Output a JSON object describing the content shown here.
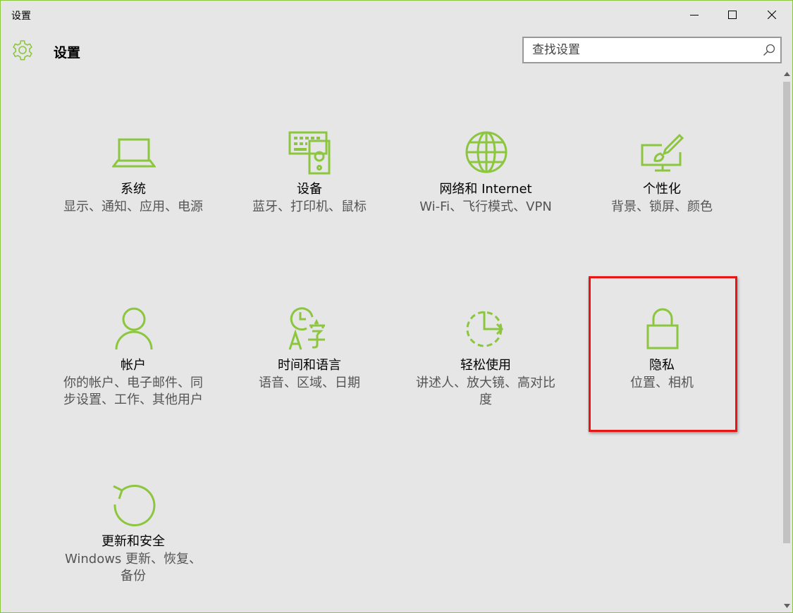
{
  "window": {
    "title": "设置"
  },
  "header": {
    "title": "设置",
    "icon": "gear-icon"
  },
  "search": {
    "placeholder": "查找设置",
    "icon": "search-icon"
  },
  "colors": {
    "accent": "#8cc63f",
    "background": "#e6e6e6",
    "highlight": "#e81515"
  },
  "tiles": [
    {
      "title": "系统",
      "desc": "显示、通知、应用、电源",
      "icon": "laptop-icon"
    },
    {
      "title": "设备",
      "desc": "蓝牙、打印机、鼠标",
      "icon": "keyboard-speaker-icon"
    },
    {
      "title": "网络和 Internet",
      "desc": "Wi-Fi、飞行模式、VPN",
      "icon": "globe-icon"
    },
    {
      "title": "个性化",
      "desc": "背景、锁屏、颜色",
      "icon": "paintbrush-monitor-icon"
    },
    {
      "title": "帐户",
      "desc": "你的帐户、电子邮件、同步设置、工作、其他用户",
      "icon": "person-icon"
    },
    {
      "title": "时间和语言",
      "desc": "语音、区域、日期",
      "icon": "clock-language-icon"
    },
    {
      "title": "轻松使用",
      "desc": "讲述人、放大镜、高对比度",
      "icon": "ease-of-access-icon"
    },
    {
      "title": "隐私",
      "desc": "位置、相机",
      "icon": "lock-icon"
    },
    {
      "title": "更新和安全",
      "desc": "Windows 更新、恢复、备份",
      "icon": "update-arrow-icon"
    }
  ]
}
